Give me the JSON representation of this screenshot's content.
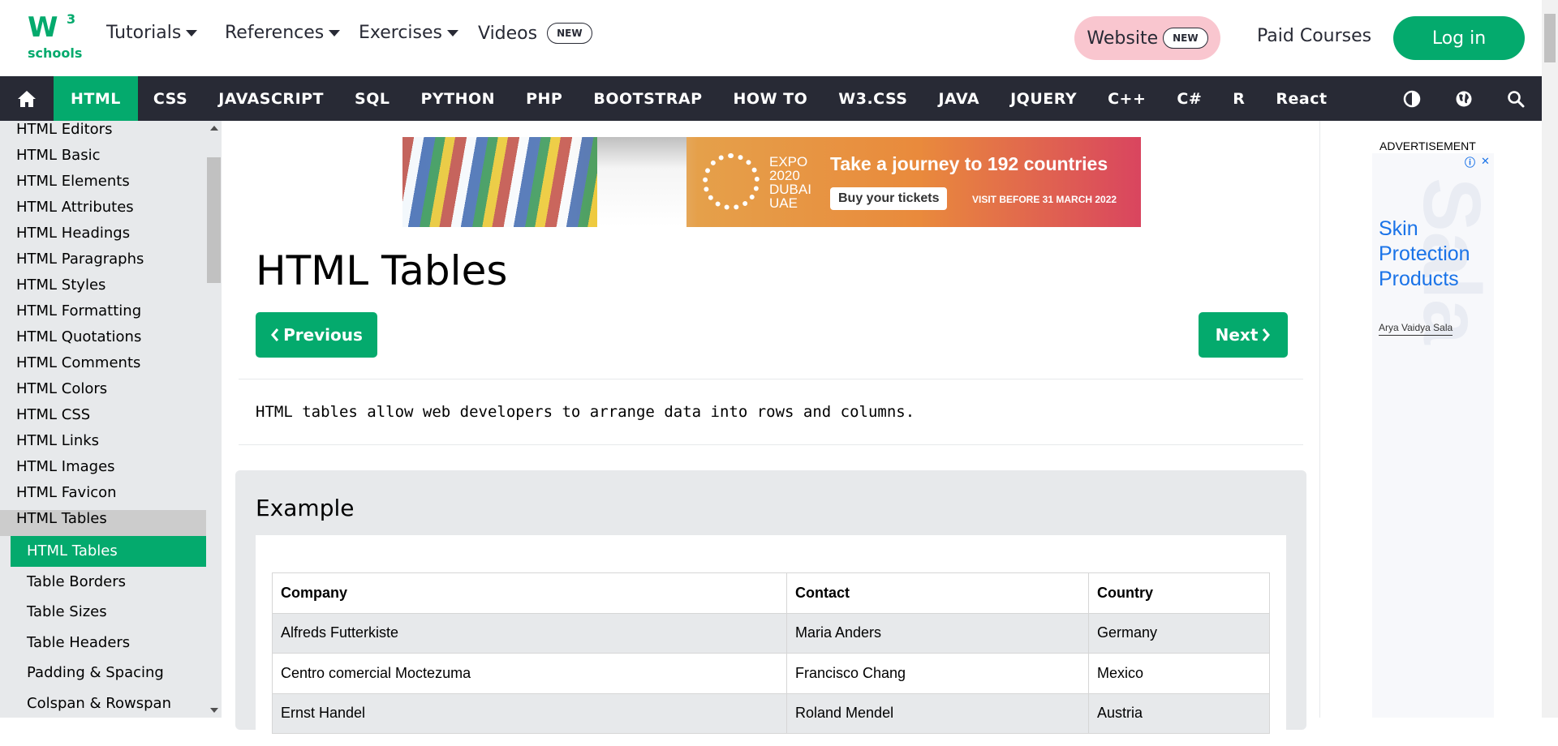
{
  "topbar": {
    "logo": {
      "mark": "W",
      "sup": "3",
      "text": "schools"
    },
    "nav": [
      {
        "label": "Tutorials"
      },
      {
        "label": "References"
      },
      {
        "label": "Exercises"
      },
      {
        "label": "Videos",
        "badge": "NEW"
      }
    ],
    "website": {
      "label": "Website",
      "badge": "NEW"
    },
    "paid_courses": "Paid Courses",
    "login": "Log in"
  },
  "mainnav": {
    "items": [
      "HTML",
      "CSS",
      "JAVASCRIPT",
      "SQL",
      "PYTHON",
      "PHP",
      "BOOTSTRAP",
      "HOW TO",
      "W3.CSS",
      "JAVA",
      "JQUERY",
      "C++",
      "C#",
      "R",
      "React"
    ],
    "active": "HTML",
    "icons": [
      "contrast-icon",
      "globe-icon",
      "search-icon"
    ]
  },
  "sidebar": {
    "items": [
      "HTML Editors",
      "HTML Basic",
      "HTML Elements",
      "HTML Attributes",
      "HTML Headings",
      "HTML Paragraphs",
      "HTML Styles",
      "HTML Formatting",
      "HTML Quotations",
      "HTML Comments",
      "HTML Colors",
      "HTML CSS",
      "HTML Links",
      "HTML Images",
      "HTML Favicon"
    ],
    "group": "HTML Tables",
    "subitems": [
      "HTML Tables",
      "Table Borders",
      "Table Sizes",
      "Table Headers",
      "Padding & Spacing",
      "Colspan & Rowspan"
    ],
    "current": "HTML Tables"
  },
  "banner": {
    "expo": [
      "EXPO",
      "2020",
      "DUBAI",
      "UAE"
    ],
    "headline": "Take a journey to 192 countries",
    "cta": "Buy your tickets",
    "note": "VISIT BEFORE 31 MARCH 2022"
  },
  "main": {
    "title": "HTML Tables",
    "prev": "Previous",
    "next": "Next",
    "intro": "HTML tables allow web developers to arrange data into rows and columns.",
    "example": {
      "heading": "Example",
      "columns": [
        "Company",
        "Contact",
        "Country"
      ],
      "rows": [
        [
          "Alfreds Futterkiste",
          "Maria Anders",
          "Germany"
        ],
        [
          "Centro comercial Moctezuma",
          "Francisco Chang",
          "Mexico"
        ],
        [
          "Ernst Handel",
          "Roland Mendel",
          "Austria"
        ]
      ]
    }
  },
  "right": {
    "label": "ADVERTISEMENT",
    "ad_title": [
      "Skin",
      "Protection",
      "Products"
    ],
    "ad_brand": "Arya Vaidya Sala",
    "ad_watermark": "Arya Vaidya Sala"
  },
  "colors": {
    "green": "#04AA6D",
    "dark": "#282A35",
    "sidebar": "#E7E9EB",
    "pink": "#F9C6CF",
    "ad_blue": "#1A73E8"
  }
}
